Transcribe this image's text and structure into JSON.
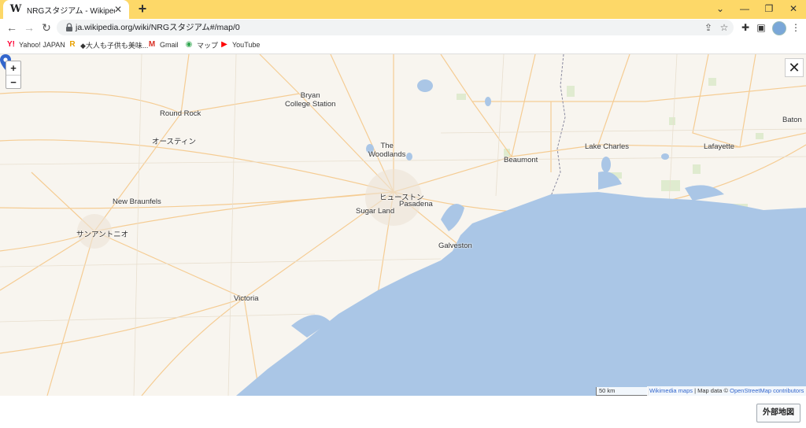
{
  "browser": {
    "tab_title": "NRGスタジアム - Wikipedia",
    "tab_favicon": "W",
    "tab_close": "✕",
    "new_tab": "+",
    "url": "ja.wikipedia.org/wiki/NRGスタジアム#/map/0",
    "accent_color": "#fdd868"
  },
  "bookmarks": [
    {
      "label": "Yahoo! JAPAN",
      "icon": "yahoo-icon",
      "glyph": "Y!",
      "color": "#ff0033"
    },
    {
      "label": "◆大人も子供も美味...",
      "icon": "rakuten-icon",
      "glyph": "R",
      "color": "#e8a000"
    },
    {
      "label": "Gmail",
      "icon": "gmail-icon",
      "glyph": "M",
      "color": "#d93025"
    },
    {
      "label": "マップ",
      "icon": "maps-icon",
      "glyph": "◉",
      "color": "#34a853"
    },
    {
      "label": "YouTube",
      "icon": "youtube-icon",
      "glyph": "▶",
      "color": "#ff0000"
    }
  ],
  "map": {
    "zoom_in": "+",
    "zoom_out": "−",
    "close": "✕",
    "scale": "50 km",
    "attribution": {
      "wikimedia": "Wikimedia maps",
      "sep": " | Map data © ",
      "osm": "OpenStreetMap contributors"
    },
    "cities": [
      {
        "name": "Bryan\nCollege Station"
      },
      {
        "name": "Round Rock"
      },
      {
        "name": "オースティン"
      },
      {
        "name": "The\nWoodlands"
      },
      {
        "name": "Beaumont"
      },
      {
        "name": "Lake Charles"
      },
      {
        "name": "Lafayette"
      },
      {
        "name": "Baton"
      },
      {
        "name": "New Braunfels"
      },
      {
        "name": "ヒューストン"
      },
      {
        "name": "Pasadena"
      },
      {
        "name": "Sugar Land"
      },
      {
        "name": "サンアントニオ"
      },
      {
        "name": "Galveston"
      },
      {
        "name": "Victoria"
      }
    ]
  },
  "footer": {
    "external_map_button": "外部地図"
  }
}
